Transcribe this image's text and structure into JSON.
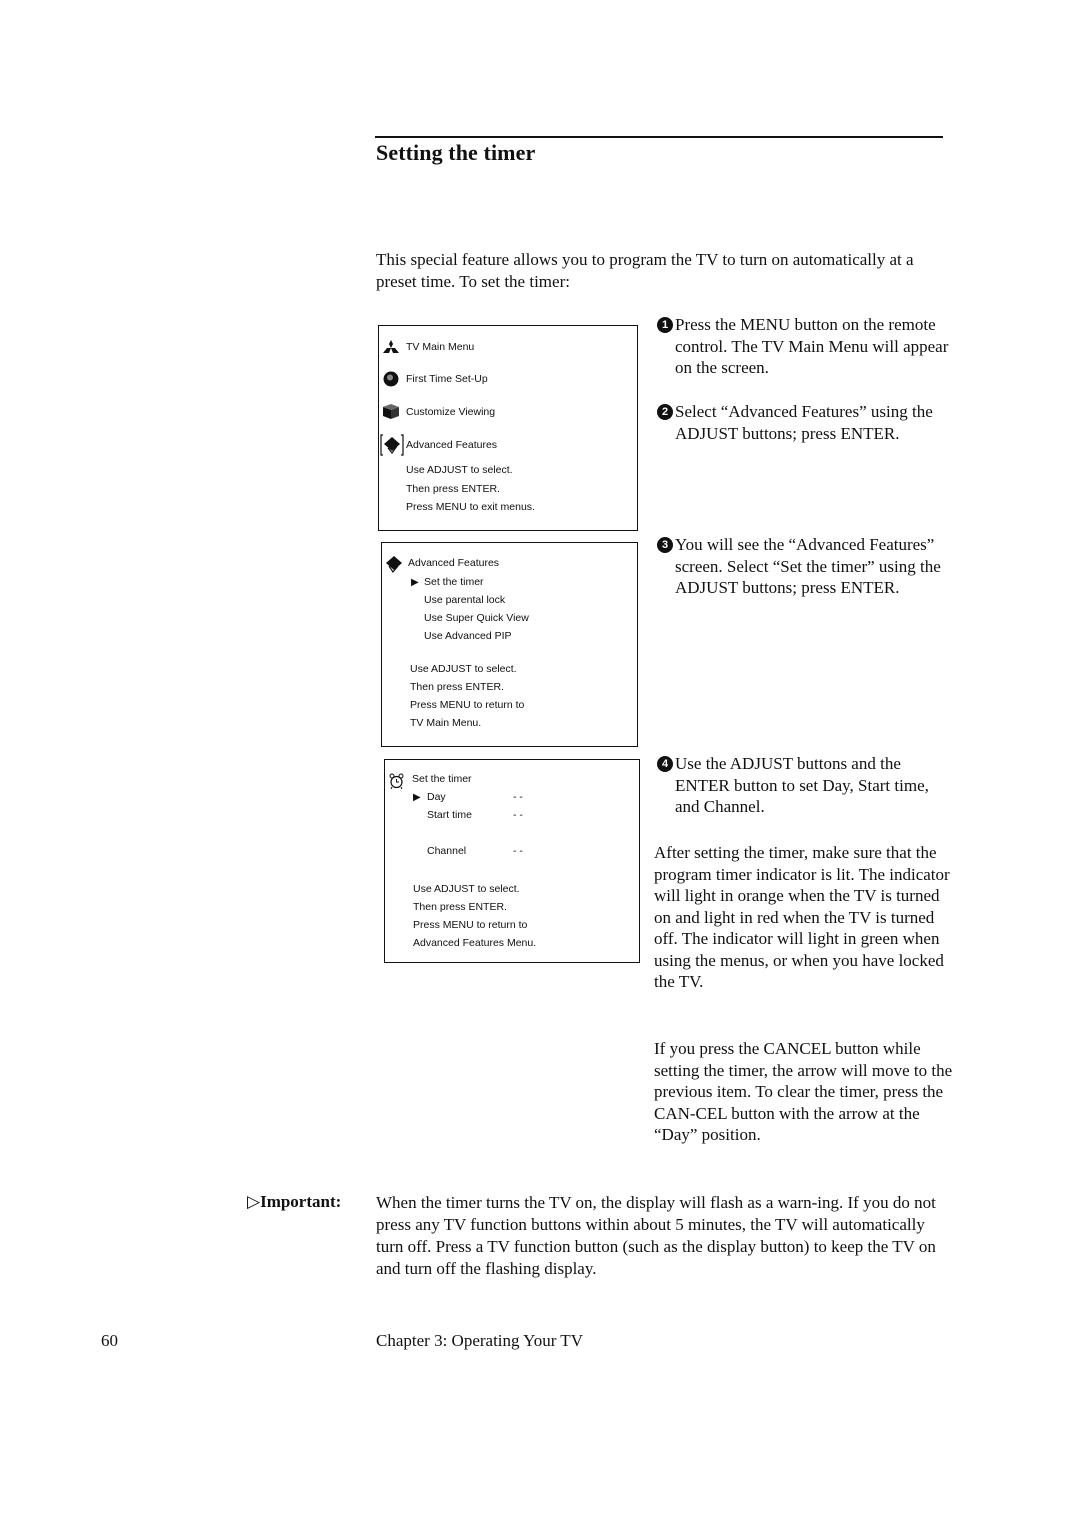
{
  "section": {
    "title": "Setting the timer",
    "intro": "This special feature allows you to program the TV to turn on automatically at a preset time. To set the timer:"
  },
  "steps": [
    {
      "number": "1",
      "text": "Press the MENU button on the remote control. The TV Main Menu will appear on the screen."
    },
    {
      "number": "2",
      "text": "Select “Advanced Features” using the ADJUST buttons; press ENTER."
    },
    {
      "number": "3",
      "text": "You will see the “Advanced Features” screen. Select “Set the timer” using the ADJUST buttons; press ENTER."
    },
    {
      "number": "4",
      "text": "Use the ADJUST buttons and the ENTER button to set Day, Start time, and Channel."
    }
  ],
  "paragraphs": {
    "after_setting": "After setting the timer, make sure that the program timer indicator is lit. The indicator will light in orange when the TV is turned on and light in red when the TV is turned off. The indicator will light in green when using the menus, or when you have locked the TV.",
    "cancel": "If you press the CANCEL button while setting the timer, the arrow will move to the previous item. To clear the timer, press the CAN-CEL button with the arrow at the “Day” position."
  },
  "screens": {
    "main_menu": {
      "title": "TV Main Menu",
      "title_icon": "logo-icon",
      "items": [
        {
          "label": "First Time Set-Up",
          "icon": "globe-icon"
        },
        {
          "label": "Customize Viewing",
          "icon": "cube-icon"
        },
        {
          "label": "Advanced Features",
          "icon": "diamond-icon",
          "selected": true
        }
      ],
      "instructions": [
        "Use ADJUST to select.",
        "Then press ENTER.",
        "Press MENU to exit menus."
      ]
    },
    "advanced_features": {
      "title": "Advanced Features",
      "title_icon": "diamond-icon",
      "items": [
        {
          "label": "Set the timer",
          "selected": true
        },
        {
          "label": "Use parental lock"
        },
        {
          "label": "Use Super Quick View"
        },
        {
          "label": "Use Advanced PIP"
        }
      ],
      "instructions": [
        "Use ADJUST to select.",
        "Then press ENTER.",
        "Press MENU to return to",
        "TV Main Menu."
      ]
    },
    "set_timer": {
      "title": "Set the timer",
      "title_icon": "alarm-clock-icon",
      "fields": [
        {
          "label": "Day",
          "value": "- -",
          "selected": true
        },
        {
          "label": "Start time",
          "value": "- -"
        },
        {
          "label": "Channel",
          "value": "- -"
        }
      ],
      "instructions": [
        "Use ADJUST to select.",
        "Then press ENTER.",
        "Press MENU to return to",
        "Advanced Features Menu."
      ]
    }
  },
  "important": {
    "marker": "▷",
    "label": "Important:",
    "text": "When the timer turns the TV on, the display will flash as a warn-ing. If you do not press any TV function buttons within about 5 minutes, the TV will automatically turn off. Press a TV function button (such as the display button) to keep the TV on and turn off the flashing display."
  },
  "footer": {
    "page_number": "60",
    "chapter": "Chapter 3: Operating Your TV"
  }
}
